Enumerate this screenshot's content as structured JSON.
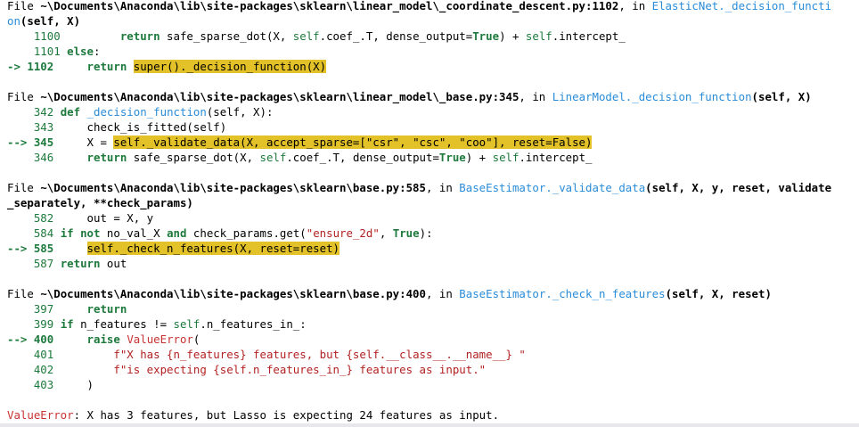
{
  "traceback": {
    "colors": {
      "arrow": "#1d7a3c",
      "line_number": "#1d7a3c",
      "function_link": "#2a8cd8",
      "keyword": "#1d7a3c",
      "string": "#b22222",
      "highlight": "#e3c229",
      "error": "#c83232"
    },
    "lines": [
      [
        {
          "c": "",
          "t": "File "
        },
        {
          "c": "fp",
          "t": "~\\Documents\\Anaconda\\lib\\site-packages\\sklearn\\linear_model\\_coordinate_descent.py:1102"
        },
        {
          "c": "",
          "t": ", in "
        },
        {
          "c": "fn",
          "t": "ElasticNet._decision_functi"
        }
      ],
      [
        {
          "c": "fn",
          "t": "on"
        },
        {
          "c": "fp",
          "t": "(self, X)"
        }
      ],
      [
        {
          "c": "lno",
          "t": "    1100 "
        },
        {
          "c": "",
          "t": "        "
        },
        {
          "c": "kw",
          "t": "return"
        },
        {
          "c": "",
          "t": " safe_sparse_dot(X, "
        },
        {
          "c": "bi",
          "t": "self"
        },
        {
          "c": "",
          "t": ".coef_.T, dense_output="
        },
        {
          "c": "kw",
          "t": "True"
        },
        {
          "c": "",
          "t": ") + "
        },
        {
          "c": "bi",
          "t": "self"
        },
        {
          "c": "",
          "t": ".intercept_"
        }
      ],
      [
        {
          "c": "lno",
          "t": "    1101 "
        },
        {
          "c": "kw",
          "t": "else"
        },
        {
          "c": "",
          "t": ":"
        }
      ],
      [
        {
          "c": "ar",
          "t": "-> 1102 "
        },
        {
          "c": "",
          "t": "    "
        },
        {
          "c": "kw",
          "t": "return"
        },
        {
          "c": "",
          "t": " "
        },
        {
          "c": "hl",
          "t": "super()._decision_function(X)"
        }
      ],
      [],
      [
        {
          "c": "",
          "t": "File "
        },
        {
          "c": "fp",
          "t": "~\\Documents\\Anaconda\\lib\\site-packages\\sklearn\\linear_model\\_base.py:345"
        },
        {
          "c": "",
          "t": ", in "
        },
        {
          "c": "fn",
          "t": "LinearModel._decision_function"
        },
        {
          "c": "fp",
          "t": "(self, X)"
        }
      ],
      [
        {
          "c": "lno",
          "t": "    342 "
        },
        {
          "c": "kw",
          "t": "def"
        },
        {
          "c": "",
          "t": " "
        },
        {
          "c": "fn",
          "t": "_decision_function"
        },
        {
          "c": "",
          "t": "(self, X):"
        }
      ],
      [
        {
          "c": "lno",
          "t": "    343 "
        },
        {
          "c": "",
          "t": "    check_is_fitted(self)"
        }
      ],
      [
        {
          "c": "ar",
          "t": "--> 345 "
        },
        {
          "c": "",
          "t": "    X = "
        },
        {
          "c": "hl",
          "t": "self._validate_data(X, accept_sparse=[\"csr\", \"csc\", \"coo\"], reset=False)"
        }
      ],
      [
        {
          "c": "lno",
          "t": "    346 "
        },
        {
          "c": "",
          "t": "    "
        },
        {
          "c": "kw",
          "t": "return"
        },
        {
          "c": "",
          "t": " safe_sparse_dot(X, "
        },
        {
          "c": "bi",
          "t": "self"
        },
        {
          "c": "",
          "t": ".coef_.T, dense_output="
        },
        {
          "c": "kw",
          "t": "True"
        },
        {
          "c": "",
          "t": ") + "
        },
        {
          "c": "bi",
          "t": "self"
        },
        {
          "c": "",
          "t": ".intercept_"
        }
      ],
      [],
      [
        {
          "c": "",
          "t": "File "
        },
        {
          "c": "fp",
          "t": "~\\Documents\\Anaconda\\lib\\site-packages\\sklearn\\base.py:585"
        },
        {
          "c": "",
          "t": ", in "
        },
        {
          "c": "fn",
          "t": "BaseEstimator._validate_data"
        },
        {
          "c": "fp",
          "t": "(self, X, y, reset, validate"
        }
      ],
      [
        {
          "c": "fp",
          "t": "_separately, **check_params)"
        }
      ],
      [
        {
          "c": "lno",
          "t": "    582 "
        },
        {
          "c": "",
          "t": "    out = X, y"
        }
      ],
      [
        {
          "c": "lno",
          "t": "    584 "
        },
        {
          "c": "kw",
          "t": "if"
        },
        {
          "c": "",
          "t": " "
        },
        {
          "c": "kw",
          "t": "not"
        },
        {
          "c": "",
          "t": " no_val_X "
        },
        {
          "c": "kw",
          "t": "and"
        },
        {
          "c": "",
          "t": " check_params.get("
        },
        {
          "c": "st",
          "t": "\"ensure_2d\""
        },
        {
          "c": "",
          "t": ", "
        },
        {
          "c": "kw",
          "t": "True"
        },
        {
          "c": "",
          "t": "):"
        }
      ],
      [
        {
          "c": "ar",
          "t": "--> 585 "
        },
        {
          "c": "",
          "t": "    "
        },
        {
          "c": "hl",
          "t": "self._check_n_features(X, reset=reset)"
        }
      ],
      [
        {
          "c": "lno",
          "t": "    587 "
        },
        {
          "c": "kw",
          "t": "return"
        },
        {
          "c": "",
          "t": " out"
        }
      ],
      [],
      [
        {
          "c": "",
          "t": "File "
        },
        {
          "c": "fp",
          "t": "~\\Documents\\Anaconda\\lib\\site-packages\\sklearn\\base.py:400"
        },
        {
          "c": "",
          "t": ", in "
        },
        {
          "c": "fn",
          "t": "BaseEstimator._check_n_features"
        },
        {
          "c": "fp",
          "t": "(self, X, reset)"
        }
      ],
      [
        {
          "c": "lno",
          "t": "    397 "
        },
        {
          "c": "",
          "t": "    "
        },
        {
          "c": "kw",
          "t": "return"
        }
      ],
      [
        {
          "c": "lno",
          "t": "    399 "
        },
        {
          "c": "kw",
          "t": "if"
        },
        {
          "c": "",
          "t": " n_features != "
        },
        {
          "c": "bi",
          "t": "self"
        },
        {
          "c": "",
          "t": ".n_features_in_:"
        }
      ],
      [
        {
          "c": "ar",
          "t": "--> 400 "
        },
        {
          "c": "",
          "t": "    "
        },
        {
          "c": "kw",
          "t": "raise"
        },
        {
          "c": "",
          "t": " "
        },
        {
          "c": "er",
          "t": "ValueError"
        },
        {
          "c": "",
          "t": "("
        }
      ],
      [
        {
          "c": "lno",
          "t": "    401 "
        },
        {
          "c": "",
          "t": "        "
        },
        {
          "c": "st",
          "t": "f\"X has {n_features} features, but {self.__class__.__name__} \""
        }
      ],
      [
        {
          "c": "lno",
          "t": "    402 "
        },
        {
          "c": "",
          "t": "        "
        },
        {
          "c": "st",
          "t": "f\"is expecting {self.n_features_in_} features as input.\""
        }
      ],
      [
        {
          "c": "lno",
          "t": "    403 "
        },
        {
          "c": "",
          "t": "    )"
        }
      ],
      [],
      [
        {
          "c": "er",
          "t": "ValueError"
        },
        {
          "c": "",
          "t": ": X has 3 features, but Lasso is expecting 24 features as input."
        }
      ]
    ]
  }
}
